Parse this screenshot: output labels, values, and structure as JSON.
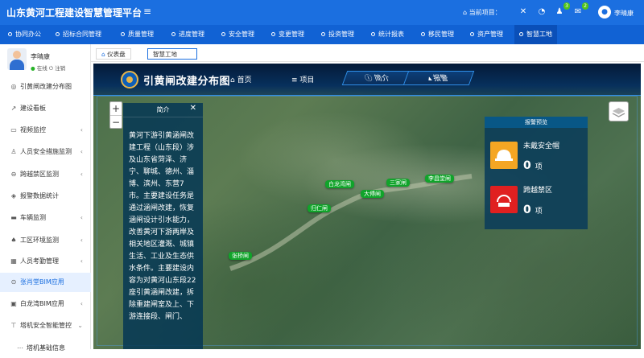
{
  "app": {
    "title": "山东黄河工程建设智慧管理平台",
    "current_project_label": "当前项目：",
    "user_name": "李晴康",
    "badges": {
      "msg": "3",
      "tasks": "2"
    }
  },
  "nav": [
    "协同办公",
    "招标合同管理",
    "质量管理",
    "进度管理",
    "安全管理",
    "变更管理",
    "投资管理",
    "统计报表",
    "移民管理",
    "资产管理",
    "智慧工地"
  ],
  "sidebar": {
    "user": {
      "name": "李晴康",
      "status_online": "在线",
      "logout": "注销"
    },
    "items": [
      {
        "label": "引黄闸改建分布图",
        "icon": "globe-icon"
      },
      {
        "label": "建设看板",
        "icon": "trend-icon"
      },
      {
        "label": "视频监控",
        "icon": "video-icon",
        "arrow": "‹"
      },
      {
        "label": "人员安全措施监测",
        "icon": "person-icon",
        "arrow": "‹"
      },
      {
        "label": "跨越禁区监测",
        "icon": "no-entry-icon",
        "arrow": "‹"
      },
      {
        "label": "报警数据统计",
        "icon": "stack-icon"
      },
      {
        "label": "车辆监测",
        "icon": "truck-icon",
        "arrow": "‹"
      },
      {
        "label": "工区环境监测",
        "icon": "tree-icon",
        "arrow": "‹"
      },
      {
        "label": "人员考勤管理",
        "icon": "calendar-icon",
        "arrow": "‹"
      },
      {
        "label": "张肖堂BIM应用",
        "icon": "circle-arrow-icon",
        "active": true
      },
      {
        "label": "白龙湾BIM应用",
        "icon": "monitor-icon",
        "arrow": "‹"
      },
      {
        "label": "塔机安全智能管控",
        "icon": "crane-icon",
        "arrow": "⌄"
      },
      {
        "label": "塔机基础信息",
        "icon": "dots-icon"
      }
    ]
  },
  "tabs": [
    {
      "label": "仪表盘",
      "icon": "home-icon"
    },
    {
      "label": "智慧工地",
      "active": true
    }
  ],
  "map": {
    "title": "引黄闸改建分布图",
    "nav": {
      "home": "首页",
      "project": "项目",
      "intro": "简介",
      "alarm": "报警"
    },
    "zoom_in": "+",
    "zoom_out": "−",
    "intro_panel": {
      "title": "简介",
      "close": "✕",
      "text": "黄河下游引黄涵闸改建工程（山东段）涉及山东省菏泽、济宁、聊城、德州、淄博、滨州、东营7市。主要建设任务是通过涵闸改建，恢复涵闸设计引水能力，改善黄河下游两岸及相关地区灌溉、城镇生活、工业及生态供水条件。主要建设内容为对黄河山东段22座引黄涵闸改建，拆除重建闸室及上、下游连接段、闸门、"
    },
    "markers": [
      {
        "name": "白龙湾闸"
      },
      {
        "name": "三家闸"
      },
      {
        "name": "李昌堂闸"
      },
      {
        "name": "大傅闸"
      },
      {
        "name": "归仁闸"
      },
      {
        "name": "张桥闸"
      }
    ],
    "warn_panel": {
      "title": "报警预览",
      "items": [
        {
          "label": "未戴安全帽",
          "count": "0",
          "unit": "项",
          "color": "#f5a623",
          "icon": "helmet-icon"
        },
        {
          "label": "跨越禁区",
          "count": "0",
          "unit": "项",
          "color": "#e02020",
          "icon": "restricted-zone-icon"
        }
      ]
    }
  }
}
